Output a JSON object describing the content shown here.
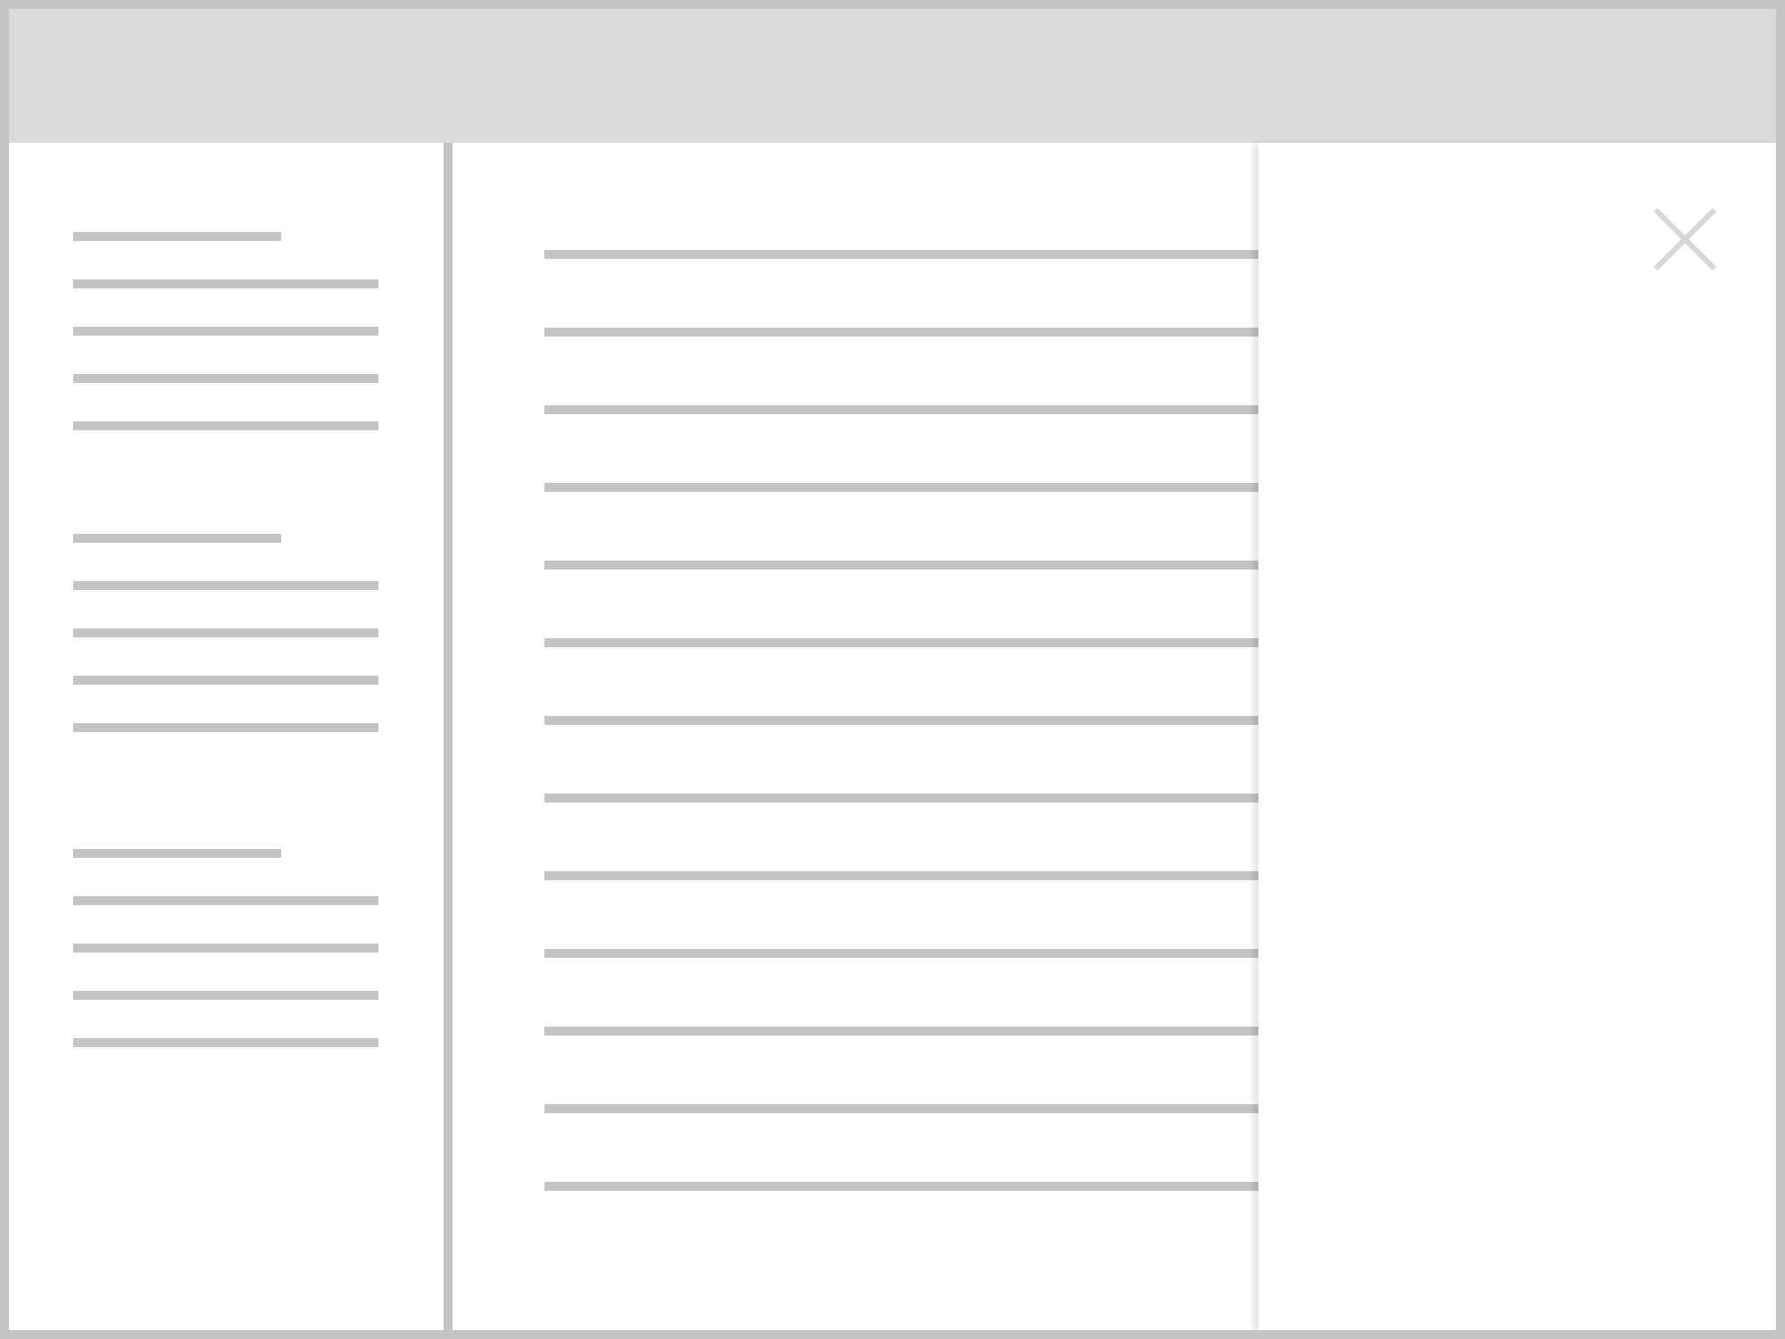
{
  "window": {
    "border_color": "#c4c4c4",
    "header_color": "#dbdbdb",
    "placeholder_color": "#c4c4c4"
  },
  "sidebar": {
    "groups": [
      {
        "lines": 5
      },
      {
        "lines": 5
      },
      {
        "lines": 5
      }
    ]
  },
  "main": {
    "rows": 13
  },
  "side_panel": {
    "close_icon": "close-icon"
  }
}
